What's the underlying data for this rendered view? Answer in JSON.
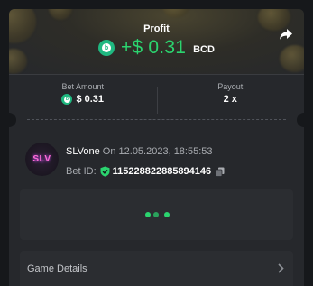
{
  "header": {
    "title": "Profit",
    "profit_value": "+$ 0.31",
    "currency": "BCD",
    "currency_icon_letter": "b"
  },
  "stats": {
    "bet_amount_label": "Bet Amount",
    "bet_amount_value": "$ 0.31",
    "payout_label": "Payout",
    "payout_value": "2 x"
  },
  "user": {
    "avatar_text": "SLV",
    "name": "SLVone",
    "date_text": "On 12.05.2023, 18:55:53",
    "bet_id_label": "Bet ID:",
    "bet_id": "115228822885894146"
  },
  "details": {
    "label": "Game Details"
  },
  "colors": {
    "accent_green": "#2bd46f",
    "bcd_green": "#1fb880",
    "card_bg": "#26282c",
    "page_bg": "#16181b"
  },
  "icons": [
    "share-icon",
    "bcd-coin-icon",
    "verified-shield-icon",
    "copy-icon",
    "chevron-right-icon",
    "loading-dots"
  ]
}
